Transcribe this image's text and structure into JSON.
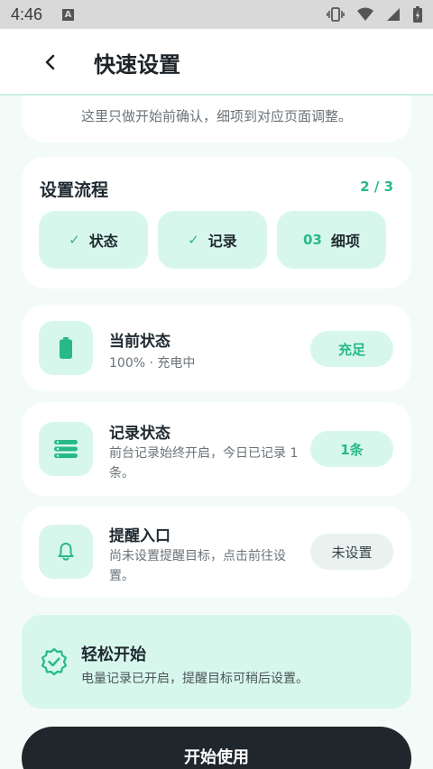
{
  "status_bar": {
    "time": "4:46",
    "notification_letter": "A",
    "icons": [
      "vibrate-icon",
      "wifi-icon",
      "signal-icon",
      "battery-charging-icon"
    ]
  },
  "header": {
    "back_icon": "chevron-left-icon",
    "title": "快速设置"
  },
  "intro": {
    "text": "这里只做开始前确认，细项到对应页面调整。"
  },
  "flow": {
    "title": "设置流程",
    "progress": "2 / 3",
    "steps": [
      {
        "marker": "✓",
        "label": "状态",
        "done": true
      },
      {
        "marker": "✓",
        "label": "记录",
        "done": true
      },
      {
        "marker": "03",
        "label": "细项",
        "done": false
      }
    ]
  },
  "cards": [
    {
      "icon": "battery-icon",
      "title": "当前状态",
      "subtitle": "100% · 充电中",
      "badge": "充足"
    },
    {
      "icon": "list-icon",
      "title": "记录状态",
      "subtitle": "前台记录始终开启，今日已记录 1 条。",
      "badge": "1条"
    },
    {
      "icon": "bell-icon",
      "title": "提醒入口",
      "subtitle": "尚未设置提醒目标，点击前往设置。",
      "badge": "未设置"
    }
  ],
  "easy_start": {
    "icon": "verified-badge-icon",
    "title": "轻松开始",
    "subtitle": "电量记录已开启，提醒目标可稍后设置。"
  },
  "primary_button": {
    "label": "开始使用"
  },
  "colors": {
    "accent": "#27b98a",
    "accent_light": "#d7f7ec",
    "background": "#f3fbf8",
    "button_dark": "#1f272c"
  }
}
